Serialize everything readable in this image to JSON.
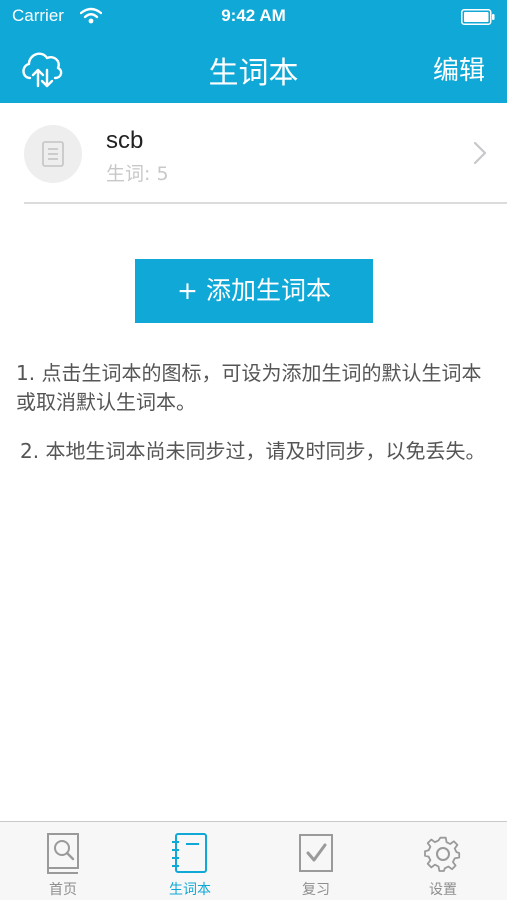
{
  "status_bar": {
    "carrier": "Carrier",
    "time": "9:42 AM"
  },
  "nav": {
    "title": "生词本",
    "edit_label": "编辑",
    "sync_icon": "cloud-sync-icon"
  },
  "wordbooks": [
    {
      "name": "scb",
      "count_label": "生词: 5"
    }
  ],
  "add_button_label": "+ 添加生词本",
  "notes": [
    "1. 点击生词本的图标，可设为添加生词的默认生词本或取消默认生词本。",
    "2. 本地生词本尚未同步过，请及时同步，以免丢失。"
  ],
  "tabs": [
    {
      "label": "首页",
      "icon": "home-book-icon",
      "active": false
    },
    {
      "label": "生词本",
      "icon": "notebook-icon",
      "active": true
    },
    {
      "label": "复习",
      "icon": "review-check-icon",
      "active": false
    },
    {
      "label": "设置",
      "icon": "gear-icon",
      "active": false
    }
  ],
  "colors": {
    "accent": "#10a8d6",
    "tab_inactive": "#8e8e8e",
    "divider": "#dcdcdc"
  }
}
